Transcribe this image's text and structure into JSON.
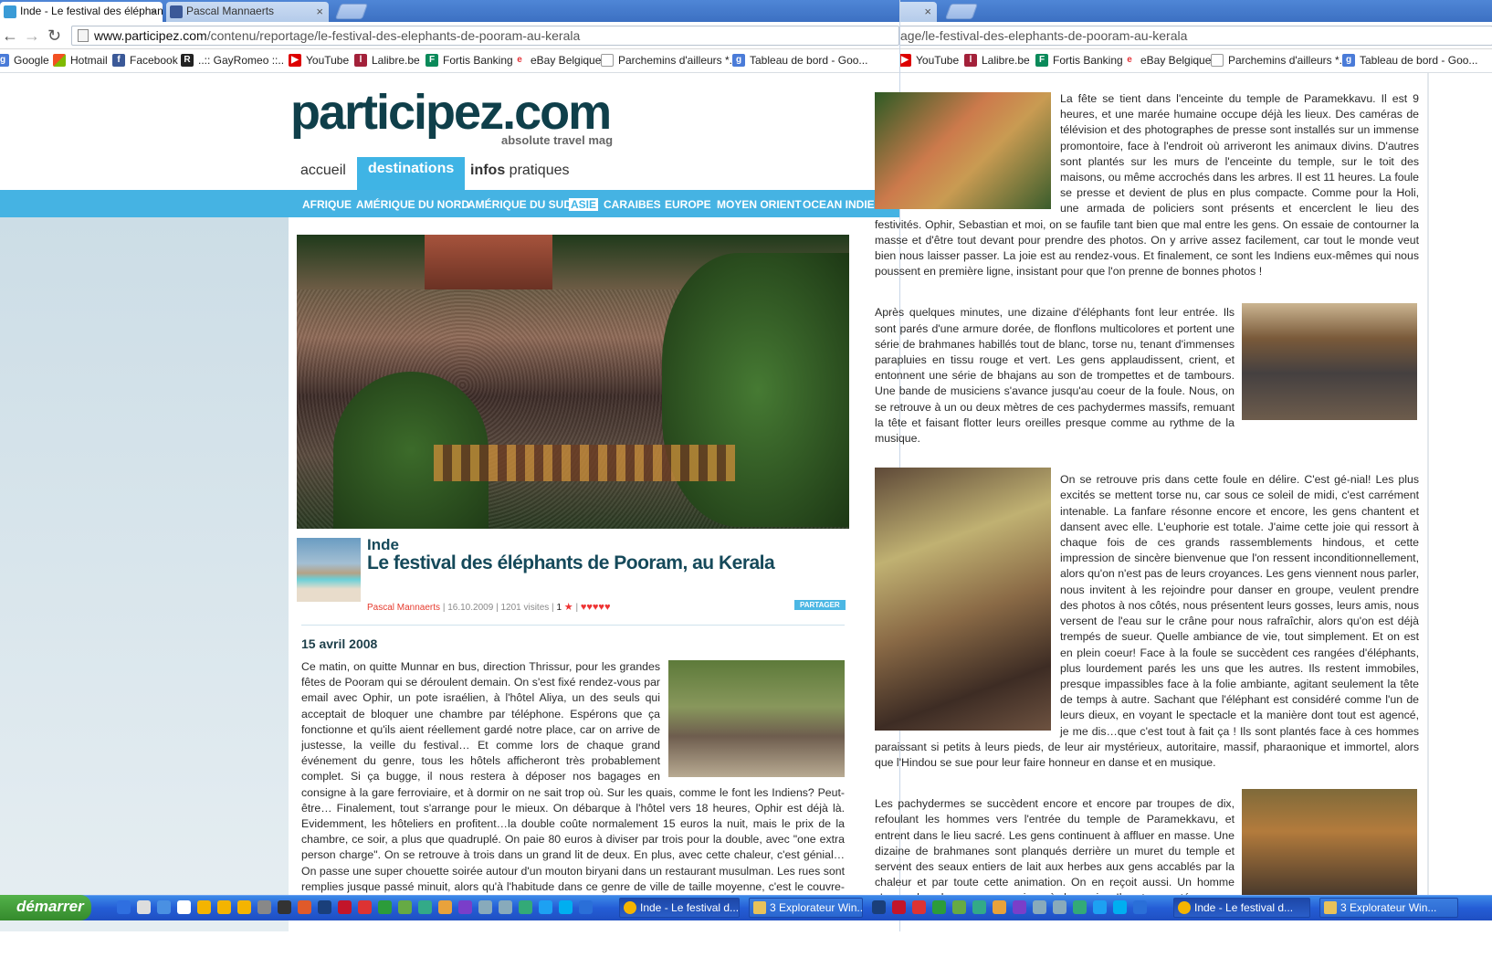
{
  "left_window": {
    "tabs": [
      {
        "title": "Inde - Le festival des éléphan",
        "active": true
      },
      {
        "title": "Pascal Mannaerts",
        "active": false
      }
    ],
    "url_domain": "www.participez.com",
    "url_path": "/contenu/reportage/le-festival-des-elephants-de-pooram-au-kerala",
    "bookmarks": [
      "Google",
      "Hotmail",
      "Facebook",
      "..:: GayRomeo ::..",
      "YouTube",
      "Lalibre.be",
      "Fortis Banking",
      "eBay Belgique",
      "Parchemins d'ailleurs *...",
      "Tableau de bord - Goo..."
    ],
    "site": {
      "logo": "participez.com",
      "tagline": "absolute travel mag",
      "nav": [
        {
          "label": "accueil"
        },
        {
          "label": "destinations"
        },
        {
          "label_bold": "infos",
          "label_rest": " pratiques"
        }
      ],
      "regions": [
        "AFRIQUE",
        "AMÉRIQUE DU NORD",
        "AMÉRIQUE DU SUD",
        "ASIE",
        "CARAIBES",
        "EUROPE",
        "MOYEN ORIENT",
        "OCEAN INDIEN"
      ],
      "selected_region": "ASIE"
    },
    "article": {
      "country": "Inde",
      "title": "Le festival des éléphants de Pooram, au Kerala",
      "author": "Pascal Mannaerts",
      "date": "16.10.2009",
      "visits": "1201 visites",
      "vote_count": "1",
      "share_label": "PARTAGER",
      "section_date": "15 avril 2008",
      "paragraph1": "Ce matin, on quitte Munnar en bus, direction Thrissur, pour les grandes fêtes de Pooram qui se déroulent demain. On s'est fixé rendez-vous par email avec Ophir, un pote israélien, à l'hôtel Aliya, un des seuls qui acceptait de bloquer une chambre par téléphone. Espérons que ça fonctionne et qu'ils aient réellement gardé notre place, car on arrive de justesse, la veille du festival… Et comme lors de chaque grand événement du genre, tous les hôtels afficheront très probablement complet. Si ça bugge, il nous restera à déposer nos bagages en consigne à la gare ferroviaire, et à dormir on ne sait trop où. Sur les quais, comme le font les Indiens? Peut-être… Finalement, tout s'arrange pour le mieux. On débarque à l'hôtel vers 18 heures, Ophir est déjà là. Evidemment, les hôteliers en profitent…la double coûte normalement 15 euros la nuit, mais le prix de la chambre, ce soir, a plus que quadruplé. On paie 80 euros à diviser par trois pour la double, avec \"one extra person charge\". On se retrouve à trois dans un grand lit de deux. En plus, avec cette chaleur, c'est génial… On passe une super chouette soirée autour d'un mouton biryani dans un restaurant musulman. Les rues sont remplies jusque passé minuit, alors qu'à l'habitude dans ce genre de ville de taille moyenne, c'est le couvre-feu une fois 21 heures. On sent"
    }
  },
  "right_window": {
    "url_path": "age/le-festival-des-elephants-de-pooram-au-kerala",
    "bookmarks": [
      "YouTube",
      "Lalibre.be",
      "Fortis Banking",
      "eBay Belgique",
      "Parchemins d'ailleurs *...",
      "Tableau de bord - Goo..."
    ],
    "paragraphs": [
      "La fête se tient dans l'enceinte du temple de Paramekkavu. Il est 9 heures, et une marée humaine occupe déjà les lieux. Des caméras de télévision et des photographes de presse sont installés sur un immense promontoire, face à l'endroit où arriveront les animaux divins. D'autres sont plantés sur les murs de l'enceinte du temple, sur le toit des maisons, ou même accrochés dans les arbres. Il est 11 heures. La foule se presse et devient de plus en plus compacte. Comme pour la Holi, une armada de policiers sont présents et encerclent le lieu des festivités. Ophir, Sebastian et moi, on se faufile tant bien que mal entre les gens. On essaie de contourner la masse et d'être tout devant pour prendre des photos. On y arrive assez facilement, car tout le monde veut bien nous laisser passer. La joie est au rendez-vous. Et finalement, ce sont les Indiens eux-mêmes qui nous poussent en première ligne, insistant pour que l'on prenne de bonnes photos !",
      "Après quelques minutes, une dizaine d'éléphants font leur entrée. Ils sont parés d'une armure dorée, de flonflons multicolores et portent une série de brahmanes habillés tout de blanc, torse nu, tenant d'immenses parapluies en tissu rouge et vert. Les gens applaudissent, crient, et entonnent une série de bhajans au son de trompettes et de tambours. Une bande de musiciens s'avance jusqu'au coeur de la foule. Nous, on se retrouve à un ou deux mètres de ces pachydermes massifs, remuant la tête et faisant flotter leurs oreilles presque comme au rythme de la musique.",
      "On se retrouve pris dans cette foule en délire. C'est gé-nial! Les plus excités se mettent torse nu, car sous ce soleil de midi, c'est carrément intenable. La fanfare résonne encore et encore, les gens chantent et dansent avec elle. L'euphorie est totale. J'aime cette joie qui ressort à chaque fois de ces grands rassemblements hindous, et cette impression de sincère bienvenue que l'on ressent inconditionnellement, alors qu'on n'est pas de leurs croyances. Les gens viennent nous parler, nous invitent à les rejoindre pour danser en groupe, veulent prendre des photos à nos côtés, nous présentent leurs gosses, leurs amis, nous versent de l'eau sur le crâne pour nous rafraîchir, alors qu'on est déjà trempés de sueur. Quelle ambiance de vie, tout simplement. Et on est en plein coeur! Face à la foule se succèdent ces rangées d'éléphants, plus lourdement parés les uns que les autres. Ils restent immobiles, presque impassibles face à la folie ambiante, agitant seulement la tête de temps à autre. Sachant que l'éléphant est considéré comme l'un de leurs dieux, en voyant le spectacle et la manière dont tout est agencé, je me dis…que c'est tout à fait ça ! Ils sont plantés face à ces hommes paraissant si petits à leurs pieds, de leur air mystérieux, autoritaire, massif, pharaonique et immortel, alors que l'Hindou se sue pour leur faire honneur en danse et en musique.",
      "Les pachydermes se succèdent encore et encore par troupes de dix, refoulant les hommes vers l'entrée du temple de Paramekkavu, et entrent dans le lieu sacré. Les gens continuent à affluer en masse. Une dizaine de brahmanes sont planqués derrière un muret du temple et servent des seaux entiers de lait aux herbes aux gens accablés par la chaleur et par toute cette animation. On en reçoit aussi. Un homme s'approche de nous, un micro à la main. Il est escorté par un cameraman et un assistant. Il"
    ]
  },
  "taskbar": {
    "start_label": "démarrer",
    "items": [
      {
        "label": "Inde - Le festival d...",
        "active": true
      },
      {
        "label": "3 Explorateur Win...",
        "active": false
      },
      {
        "label": "Inde - Le festival d...",
        "active": true
      },
      {
        "label": "3 Explorateur Win...",
        "active": false
      }
    ]
  }
}
